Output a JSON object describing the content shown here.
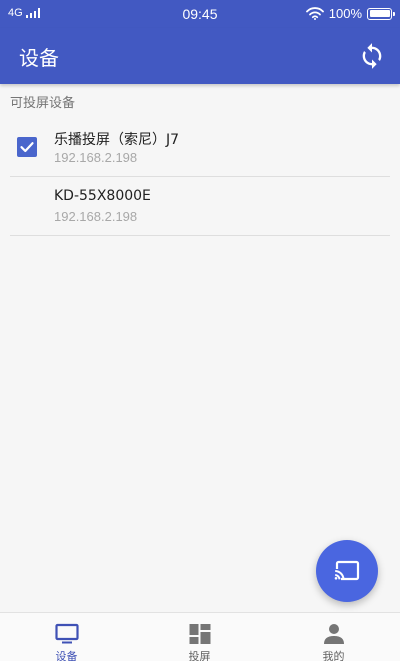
{
  "colors": {
    "primary": "#4259c2",
    "accent": "#4a66e0",
    "active_tab": "#3f51b5"
  },
  "status_bar": {
    "network": "4G",
    "time": "09:45",
    "battery": "100%"
  },
  "app_bar": {
    "title": "设备",
    "action_icon": "refresh-icon"
  },
  "section": {
    "label": "可投屏设备"
  },
  "devices": [
    {
      "name": "乐播投屏（索尼）J7",
      "ip": "192.168.2.198",
      "checked": true
    },
    {
      "name": "KD-55X8000E",
      "ip": "192.168.2.198",
      "checked": false
    }
  ],
  "fab": {
    "icon": "cast-icon"
  },
  "bottom_nav": {
    "items": [
      {
        "label": "设备",
        "icon": "tv-icon",
        "active": true
      },
      {
        "label": "投屏",
        "icon": "grid-icon",
        "active": false
      },
      {
        "label": "我的",
        "icon": "person-icon",
        "active": false
      }
    ]
  }
}
